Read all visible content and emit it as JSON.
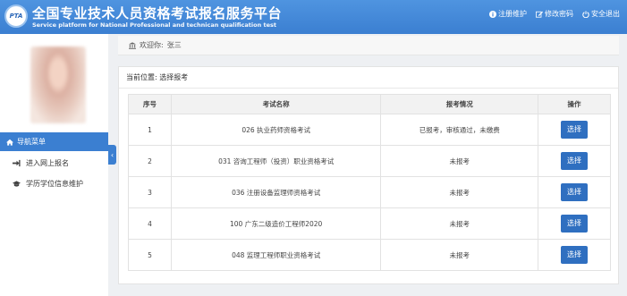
{
  "header": {
    "logo_text": "PTA",
    "title": "全国专业技术人员资格考试报名服务平台",
    "subtitle": "Service platform for National Professional and technican qualification test",
    "links": [
      {
        "label": "注册维护",
        "icon": "info-icon"
      },
      {
        "label": "修改密码",
        "icon": "edit-icon"
      },
      {
        "label": "安全退出",
        "icon": "power-icon"
      }
    ]
  },
  "sidebar": {
    "nav_title": "导航菜单",
    "items": [
      {
        "label": "进入网上报名",
        "icon": "signin-icon"
      },
      {
        "label": "学历学位信息维护",
        "icon": "graduation-cap-icon"
      }
    ]
  },
  "welcome": {
    "prefix": "欢迎你:",
    "user": "张三"
  },
  "breadcrumb": "当前位置: 选择报考",
  "table": {
    "headers": [
      "序号",
      "考试名称",
      "报考情况",
      "操作"
    ],
    "rows": [
      {
        "no": "1",
        "name": "026 执业药师资格考试",
        "status": "已报考，审核通过，未缴费",
        "action": "选择"
      },
      {
        "no": "2",
        "name": "031 咨询工程师（投资）职业资格考试",
        "status": "未报考",
        "action": "选择"
      },
      {
        "no": "3",
        "name": "036 注册设备监理师资格考试",
        "status": "未报考",
        "action": "选择"
      },
      {
        "no": "4",
        "name": "100 广东二级造价工程师2020",
        "status": "未报考",
        "action": "选择"
      },
      {
        "no": "5",
        "name": "048 监理工程师职业资格考试",
        "status": "未报考",
        "action": "选择"
      }
    ]
  },
  "colors": {
    "brand": "#3b7fd1",
    "button": "#2f6fc0"
  }
}
